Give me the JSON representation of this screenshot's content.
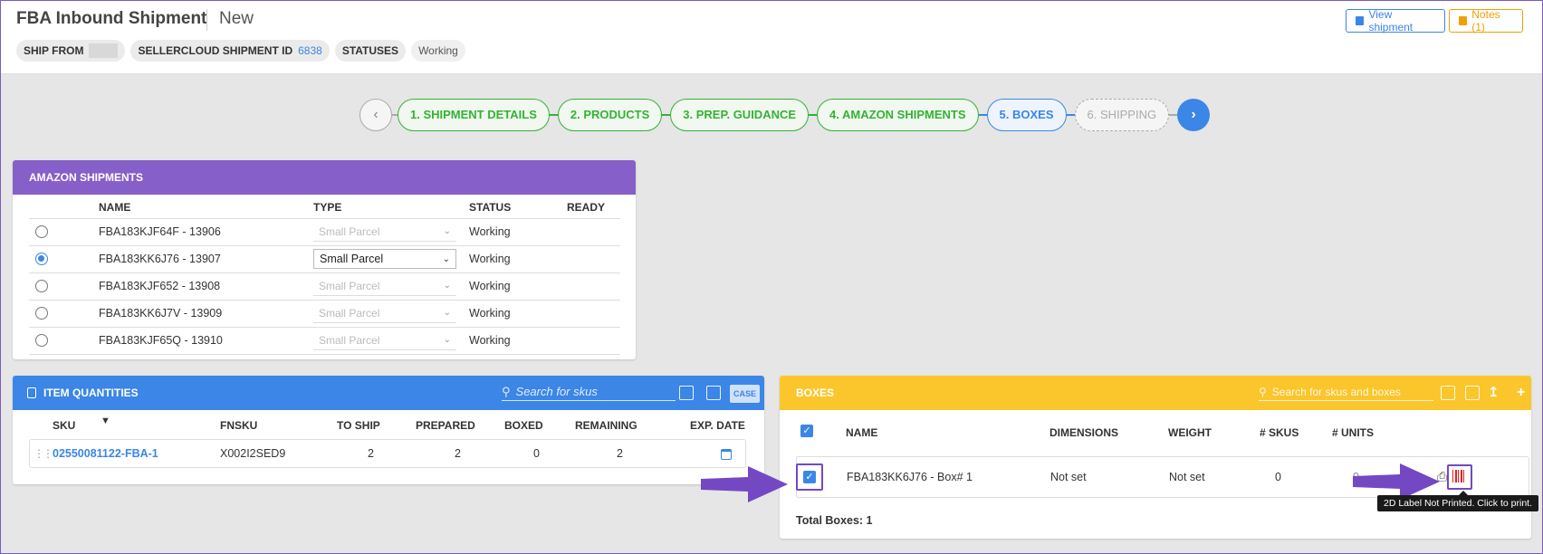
{
  "header": {
    "title": "FBA Inbound Shipment",
    "subtitle": "New",
    "chips": {
      "ship_from_label": "SHIP FROM",
      "shipment_id_label": "SELLERCLOUD SHIPMENT ID",
      "shipment_id_value": "6838",
      "statuses_label": "STATUSES",
      "status_value": "Working"
    },
    "view_shipment_label": "View shipment",
    "notes_label": "Notes (1)"
  },
  "stepper": {
    "steps": [
      {
        "label": "1. SHIPMENT DETAILS",
        "state": "done"
      },
      {
        "label": "2. PRODUCTS",
        "state": "done"
      },
      {
        "label": "3. PREP. GUIDANCE",
        "state": "done"
      },
      {
        "label": "4. AMAZON SHIPMENTS",
        "state": "done"
      },
      {
        "label": "5. BOXES",
        "state": "active"
      },
      {
        "label": "6. SHIPPING",
        "state": "pending"
      }
    ],
    "prev_icon": "chevron-left-icon",
    "next_icon": "chevron-right-icon"
  },
  "amazon_shipments": {
    "title": "AMAZON SHIPMENTS",
    "columns": {
      "name": "NAME",
      "type": "TYPE",
      "status": "STATUS",
      "ready": "READY"
    },
    "rows": [
      {
        "name": "FBA183KJF64F - 13906",
        "type": "Small Parcel",
        "status": "Working",
        "selected": false
      },
      {
        "name": "FBA183KK6J76 - 13907",
        "type": "Small Parcel",
        "status": "Working",
        "selected": true
      },
      {
        "name": "FBA183KJF652 - 13908",
        "type": "Small Parcel",
        "status": "Working",
        "selected": false
      },
      {
        "name": "FBA183KK6J7V - 13909",
        "type": "Small Parcel",
        "status": "Working",
        "selected": false
      },
      {
        "name": "FBA183KJF65Q - 13910",
        "type": "Small Parcel",
        "status": "Working",
        "selected": false
      }
    ]
  },
  "item_quantities": {
    "title": "ITEM QUANTITIES",
    "search_placeholder": "Search for skus",
    "case_label": "CASE",
    "columns": {
      "sku": "SKU",
      "fnsku": "FNSKU",
      "to_ship": "TO SHIP",
      "prepared": "PREPARED",
      "boxed": "BOXED",
      "remaining": "REMAINING",
      "exp_date": "EXP. DATE"
    },
    "rows": [
      {
        "sku": "02550081122-FBA-1",
        "fnsku": "X002I2SED9",
        "to_ship": "2",
        "prepared": "2",
        "boxed": "0",
        "remaining": "2"
      }
    ]
  },
  "boxes": {
    "title": "BOXES",
    "search_placeholder": "Search for skus and boxes",
    "columns": {
      "name": "NAME",
      "dimensions": "DIMENSIONS",
      "weight": "WEIGHT",
      "skus": "# SKUS",
      "units": "# UNITS"
    },
    "rows": [
      {
        "name": "FBA183KK6J76 - Box# 1",
        "dimensions": "Not set",
        "weight": "Not set",
        "skus": "0",
        "units": "0",
        "checked": true
      }
    ],
    "total_label": "Total Boxes: 1",
    "tooltip": "2D Label Not Printed. Click to print."
  },
  "colors": {
    "accent_blue": "#3b86e6",
    "step_green": "#34b234",
    "panel_purple": "#8660c8",
    "panel_yellow": "#fbc62c",
    "highlight_purple": "#7448c2",
    "label_red": "#e02020"
  }
}
